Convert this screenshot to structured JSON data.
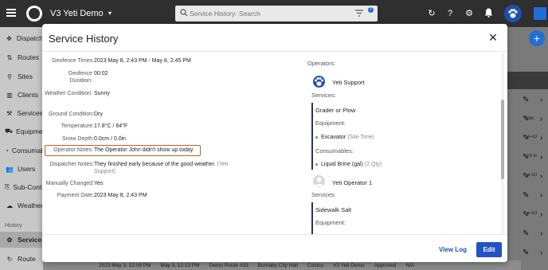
{
  "app": {
    "title": "V3 Yeti Demo",
    "search_placeholder": "Service History: Search",
    "help_badge": "?"
  },
  "sidebar": {
    "items": [
      {
        "label": "Dispatch",
        "icon": "dispatch-icon"
      },
      {
        "label": "Routes",
        "icon": "routes-icon"
      },
      {
        "label": "Sites",
        "icon": "sites-icon"
      },
      {
        "label": "Clients",
        "icon": "clients-icon"
      },
      {
        "label": "Services",
        "icon": "services-icon"
      },
      {
        "label": "Equipment",
        "icon": "equipment-icon"
      },
      {
        "label": "Consumables",
        "icon": "consumables-icon"
      },
      {
        "label": "Users",
        "icon": "users-icon"
      },
      {
        "label": "Sub-Contractors",
        "icon": "subcontractors-icon"
      },
      {
        "label": "Weather",
        "icon": "weather-icon"
      }
    ],
    "section_header": "History",
    "history_items": [
      {
        "label": "Service",
        "icon": "service-icon"
      },
      {
        "label": "Route",
        "icon": "route-icon"
      }
    ]
  },
  "background": {
    "snippets": [
      "low: ",
      "e-ici",
      "nt-ic",
      "e-ici",
      "e-ici"
    ],
    "bottom_row": [
      "2023 May 3, 12:09 PM",
      "May 3, 12:13 PM",
      "Demo Route #33",
      "Burnaby City Hall",
      "Costco",
      "V3 Yeti Demo",
      "Approved",
      "N/A"
    ]
  },
  "modal": {
    "title": "Service History",
    "fields": [
      {
        "label": "Geofence Times:",
        "value": "2023 May 8, 2:43 PM - May 8, 2:45 PM"
      },
      {
        "label": "Geofence Duration:",
        "value": "00:02"
      },
      {
        "label": "Weather Condition:",
        "value": "Sunny"
      },
      {
        "label": "Ground Condition:",
        "value": "Dry"
      },
      {
        "label": "Temperature:",
        "value": "17.8°C / 64°F"
      },
      {
        "label": "Snow Depth:",
        "value": "0.0cm / 0.0in"
      },
      {
        "label": "Operator Notes:",
        "value": "The Operator John didn't show up today."
      },
      {
        "label": "Dispatcher Notes:",
        "value": "They finished early because of the good weather.",
        "meta": "(Yeti Support)"
      },
      {
        "label": "Manually Changed:",
        "value": "Yes"
      },
      {
        "label": "Payment Date:",
        "value": "2023 May 8, 2:43 PM"
      }
    ],
    "operators_label": "Operators:",
    "operators": [
      {
        "name": "Yeti Support",
        "services_label": "Services:",
        "service": "Grader or Plow",
        "equipment_label": "Equipment:",
        "equipment": "Excavator",
        "equipment_meta": "(Site Time)",
        "consumables_label": "Consumables:",
        "consumable": "Liquid Brine (gal)",
        "consumable_meta": "(2 Qty)"
      },
      {
        "name": "Yeti Operator 1",
        "services_label": "Services:",
        "service": "Sidewalk Salt",
        "equipment_label": "Equipment:"
      }
    ],
    "footer": {
      "view_log": "View Log",
      "edit": "Edit"
    }
  },
  "colors": {
    "primary": "#2352c4",
    "topbar": "#2f2f2f",
    "highlight": "#b5651d"
  }
}
